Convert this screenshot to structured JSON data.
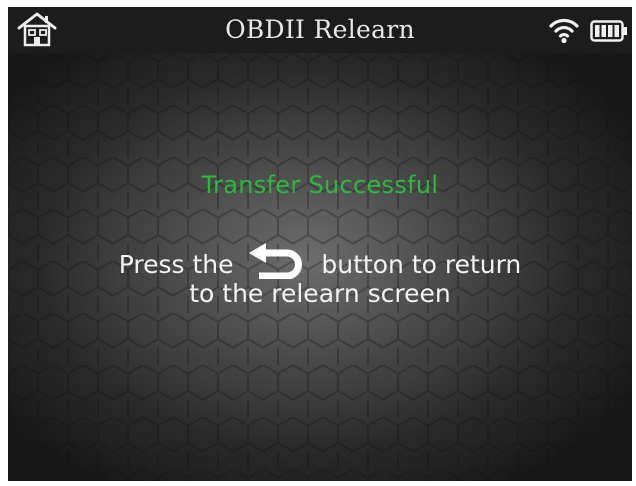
{
  "header": {
    "title": "OBDII Relearn",
    "icons": {
      "home": "home-icon",
      "wifi": "wifi-icon",
      "battery": "battery-full-icon"
    }
  },
  "message": {
    "title": "Transfer Successful",
    "line1_before": "Press the",
    "line1_after": "button to return",
    "line2": "to the relearn screen",
    "inline_icon": "back-arrow-icon"
  },
  "colors": {
    "success_text": "#2db83d",
    "body_text": "#f2f2f2",
    "titlebar_bg": "#1c1c1c"
  }
}
